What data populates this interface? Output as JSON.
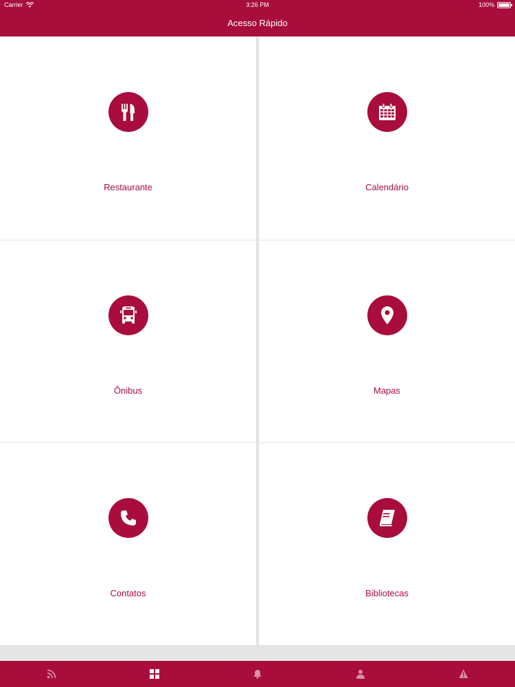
{
  "status_bar": {
    "carrier": "Carrier",
    "time": "3:26 PM",
    "battery": "100%"
  },
  "navbar": {
    "title": "Acesso Rápido"
  },
  "tiles": [
    {
      "label": "Restaurante",
      "icon": "fork-knife-icon"
    },
    {
      "label": "Calendário",
      "icon": "calendar-icon"
    },
    {
      "label": "Ônibus",
      "icon": "bus-icon"
    },
    {
      "label": "Mapas",
      "icon": "map-pin-icon"
    },
    {
      "label": "Contatos",
      "icon": "phone-icon"
    },
    {
      "label": "Bibliotecas",
      "icon": "book-icon"
    }
  ],
  "tabbar": {
    "tabs": [
      {
        "icon": "rss-icon",
        "active": false
      },
      {
        "icon": "grid-icon",
        "active": true
      },
      {
        "icon": "bell-icon",
        "active": false
      },
      {
        "icon": "user-icon",
        "active": false
      },
      {
        "icon": "warning-icon",
        "active": false
      }
    ]
  },
  "colors": {
    "brand": "#a80d3c",
    "background": "#e6e6e6",
    "tile": "#ffffff"
  }
}
